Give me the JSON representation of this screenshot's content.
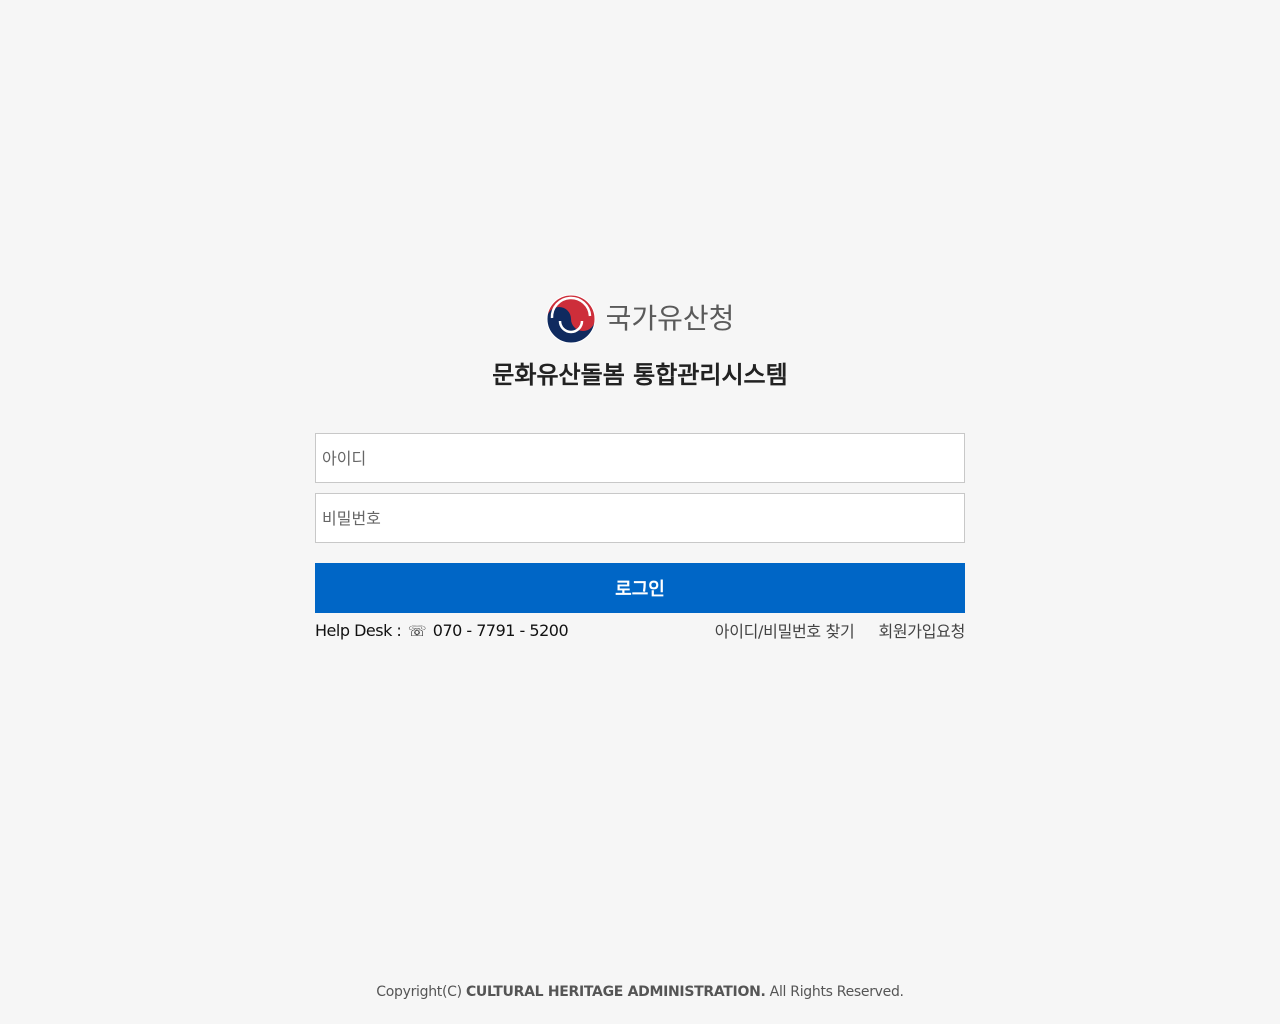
{
  "brand": {
    "agency_name": "국가유산청",
    "logo_icon": "taegeuk-logo-icon",
    "colors": {
      "red": "#cd2e3a",
      "navy": "#0f2a5f"
    }
  },
  "system_title": "문화유산돌봄 통합관리시스템",
  "login_form": {
    "id_placeholder": "아이디",
    "password_placeholder": "비밀번호",
    "login_label": "로그인",
    "accent_color": "#0066c6"
  },
  "help_desk": {
    "label": "Help Desk :",
    "phone_icon": "☏",
    "phone": "070 - 7791 - 5200"
  },
  "links": {
    "find_account": "아이디/비밀번호 찾기",
    "signup_request": "회원가입요청"
  },
  "footer": {
    "prefix": "Copyright(C) ",
    "org": "CULTURAL HERITAGE ADMINISTRATION.",
    "suffix": " All Rights Reserved."
  }
}
